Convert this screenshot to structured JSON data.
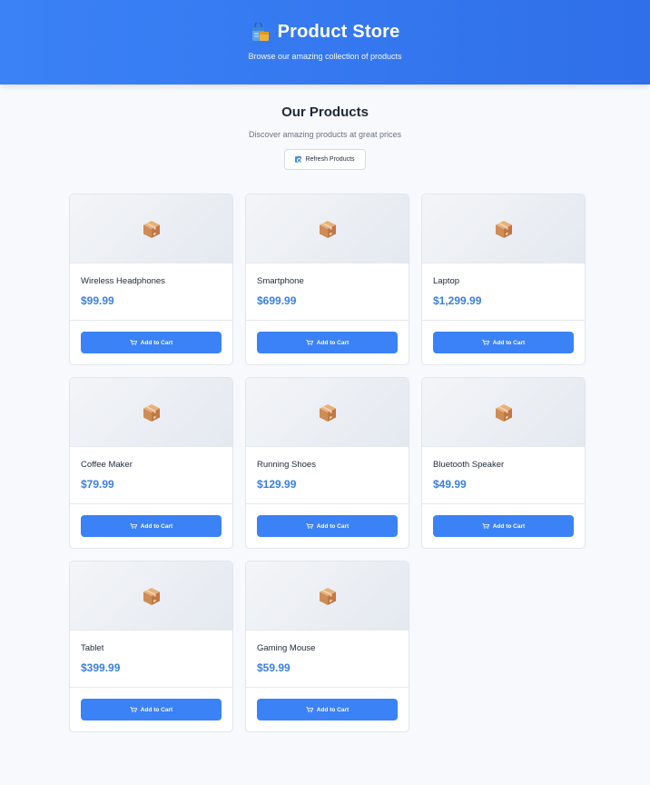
{
  "header": {
    "title": "Product Store",
    "subtitle": "Browse our amazing collection of products",
    "icon": "shopping-bags-icon"
  },
  "section": {
    "title": "Our Products",
    "subtitle": "Discover amazing products at great prices",
    "refresh_label": "Refresh Products"
  },
  "products": [
    {
      "name": "Wireless Headphones",
      "price": "$99.99",
      "button": "Add to Cart"
    },
    {
      "name": "Smartphone",
      "price": "$699.99",
      "button": "Add to Cart"
    },
    {
      "name": "Laptop",
      "price": "$1,299.99",
      "button": "Add to Cart"
    },
    {
      "name": "Coffee Maker",
      "price": "$79.99",
      "button": "Add to Cart"
    },
    {
      "name": "Running Shoes",
      "price": "$129.99",
      "button": "Add to Cart"
    },
    {
      "name": "Bluetooth Speaker",
      "price": "$49.99",
      "button": "Add to Cart"
    },
    {
      "name": "Tablet",
      "price": "$399.99",
      "button": "Add to Cart"
    },
    {
      "name": "Gaming Mouse",
      "price": "$59.99",
      "button": "Add to Cart"
    }
  ],
  "colors": {
    "accent": "#3b82f6",
    "price": "#3b7fe3",
    "background": "#f7f9fc"
  }
}
